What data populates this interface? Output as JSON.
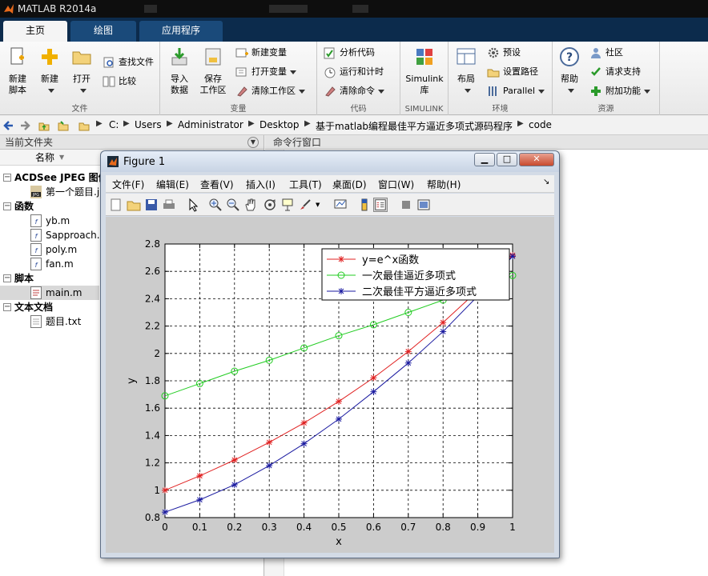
{
  "app": {
    "title": "MATLAB R2014a"
  },
  "tabs": [
    {
      "label": "主页",
      "active": true
    },
    {
      "label": "绘图",
      "active": false
    },
    {
      "label": "应用程序",
      "active": false
    }
  ],
  "ribbon": {
    "file": {
      "label": "文件",
      "new_script": [
        "新建",
        "脚本"
      ],
      "new": "新建",
      "open": "打开",
      "find_files": "查找文件",
      "compare": "比较"
    },
    "variable": {
      "label": "变量",
      "import_data": [
        "导入",
        "数据"
      ],
      "save_workspace": [
        "保存",
        "工作区"
      ],
      "new_variable": "新建变量",
      "open_variable": "打开变量",
      "clear_workspace": "清除工作区"
    },
    "code": {
      "label": "代码",
      "analyze_code": "分析代码",
      "run_and_time": "运行和计时",
      "clear_commands": "清除命令"
    },
    "simulink": {
      "label": "SIMULINK",
      "library": [
        "Simulink",
        "库"
      ]
    },
    "environment": {
      "label": "环境",
      "layout": "布局",
      "preferences": "预设",
      "set_path": "设置路径",
      "parallel": "Parallel"
    },
    "resources": {
      "label": "资源",
      "help": "帮助",
      "community": "社区",
      "request_support": "请求支持",
      "addons": "附加功能"
    }
  },
  "path": [
    "C:",
    "Users",
    "Administrator",
    "Desktop",
    "基于matlab编程最佳平方逼近多项式源码程序",
    "code"
  ],
  "current_folder": {
    "title": "当前文件夹",
    "column": "名称",
    "groups": [
      {
        "name": "ACDSee JPEG 图像",
        "files": [
          "第一个题目.jpg"
        ]
      },
      {
        "name": "函数",
        "files": [
          "yb.m",
          "Sapproach.m",
          "poly.m",
          "fan.m"
        ]
      },
      {
        "name": "脚本",
        "files": [
          "main.m"
        ]
      },
      {
        "name": "文本文档",
        "files": [
          "题目.txt"
        ]
      }
    ]
  },
  "command_window": {
    "title": "命令行窗口"
  },
  "figure": {
    "title": "Figure 1",
    "menu": [
      "文件(F)",
      "编辑(E)",
      "查看(V)",
      "插入(I)",
      "工具(T)",
      "桌面(D)",
      "窗口(W)",
      "帮助(H)"
    ]
  },
  "chart_data": {
    "type": "line",
    "xlabel": "x",
    "ylabel": "y",
    "xlim": [
      0,
      1
    ],
    "ylim": [
      0.8,
      2.8
    ],
    "xticks": [
      "0",
      "0.1",
      "0.2",
      "0.3",
      "0.4",
      "0.5",
      "0.6",
      "0.7",
      "0.8",
      "0.9",
      "1"
    ],
    "yticks": [
      "0.8",
      "1",
      "1.2",
      "1.4",
      "1.6",
      "1.8",
      "2",
      "2.2",
      "2.4",
      "2.6",
      "2.8"
    ],
    "grid": true,
    "legend_position": "top-right",
    "x": [
      0,
      0.1,
      0.2,
      0.3,
      0.4,
      0.5,
      0.6,
      0.7,
      0.8,
      0.9,
      1.0
    ],
    "series": [
      {
        "name": "y=e^x函数",
        "color": "#e02020",
        "marker": "*",
        "values": [
          1.0,
          1.105,
          1.221,
          1.35,
          1.492,
          1.649,
          1.822,
          2.014,
          2.226,
          2.46,
          2.718
        ]
      },
      {
        "name": "一次最佳逼近多项式",
        "color": "#22cc22",
        "marker": "o",
        "values": [
          1.69,
          1.78,
          1.87,
          1.95,
          2.04,
          2.13,
          2.21,
          2.3,
          2.39,
          2.48,
          2.57
        ]
      },
      {
        "name": "二次最佳平方逼近多项式",
        "color": "#1a1aa0",
        "marker": "*",
        "values": [
          0.84,
          0.93,
          1.04,
          1.18,
          1.34,
          1.52,
          1.72,
          1.93,
          2.16,
          2.42,
          2.71
        ]
      }
    ]
  }
}
